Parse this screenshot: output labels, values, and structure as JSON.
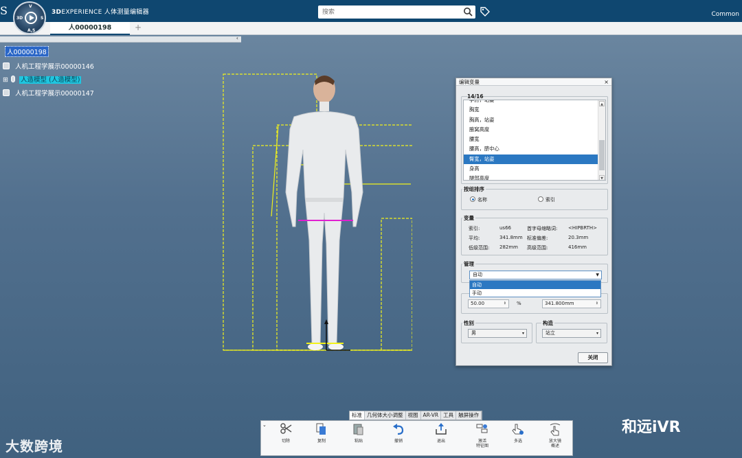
{
  "app": {
    "brand_prefix": "3D",
    "brand_rest": "EXPERIENCE",
    "title": "人体测量编辑器",
    "user": "Common",
    "logo_text": "S"
  },
  "search": {
    "placeholder": "搜索"
  },
  "tabs": {
    "active": "人00000198",
    "add": "+"
  },
  "collapse_glyph": "‹",
  "tree": {
    "root": "人00000198",
    "items": [
      {
        "label": "人机工程学展示00000146",
        "highlight": false
      },
      {
        "label": "人造模型 (人造模型)",
        "highlight": true
      },
      {
        "label": "人机工程学展示00000147",
        "highlight": false
      }
    ]
  },
  "dialog": {
    "title": "编辑变量",
    "close_glyph": "×",
    "count": "14/16",
    "variables": [
      "手肘，站姿",
      "胸宽",
      "胸高，站姿",
      "腋窝高度",
      "腰宽",
      "腰高，脐中心",
      "臀宽，站姿",
      "身高",
      "腿部高度"
    ],
    "selected_index": 6,
    "sort_group": {
      "label": "按组排序",
      "options": [
        "名称",
        "索引"
      ],
      "selected": 0
    },
    "variable_group": {
      "label": "变量",
      "rows": [
        {
          "k1": "索引:",
          "v1": "us66",
          "k2": "首字母缩略词:",
          "v2": "<HIPBRTH>"
        },
        {
          "k1": "平均:",
          "v1": "341.8mm",
          "k2": "标准偏差:",
          "v2": "20.3mm"
        },
        {
          "k1": "低级范围:",
          "v1": "282mm",
          "k2": "高级范围:",
          "v2": "416mm"
        }
      ]
    },
    "manage_group": {
      "label": "管理",
      "value": "自动",
      "options": [
        "自动",
        "手动"
      ],
      "highlighted": 0
    },
    "percent": {
      "value": "50.00",
      "unit": "%",
      "mm": "341.800mm"
    },
    "gender": {
      "label": "性别",
      "value": "男"
    },
    "posture": {
      "label": "构造",
      "value": "站立"
    },
    "close_label": "关闭"
  },
  "toolbar": {
    "tabs": [
      "标准",
      "几何体大小调整",
      "视图",
      "AR-VR",
      "工具",
      "触屏操作"
    ],
    "active_tab": 0,
    "tools": [
      {
        "label": "切除",
        "icon": "scissors-icon"
      },
      {
        "label": "复制",
        "icon": "copy-icon"
      },
      {
        "label": "粘贴",
        "icon": "paste-icon"
      },
      {
        "label": "撤销",
        "icon": "undo-icon"
      },
      {
        "label": "退出",
        "icon": "export-icon"
      },
      {
        "label": "激活\n特征图",
        "icon": "activate-icon"
      },
      {
        "label": "多选",
        "icon": "multiselect-icon"
      },
      {
        "label": "放大镜\n概述",
        "icon": "magnifier-icon"
      }
    ]
  },
  "watermarks": {
    "left": "大数跨境",
    "right": "和远iVR"
  },
  "colors": {
    "header": "#0f4770",
    "selection": "#2b78c2",
    "tree_highlight": "#1fc6e0",
    "dimension": "#f2f21a",
    "measure": "#e020d0"
  }
}
